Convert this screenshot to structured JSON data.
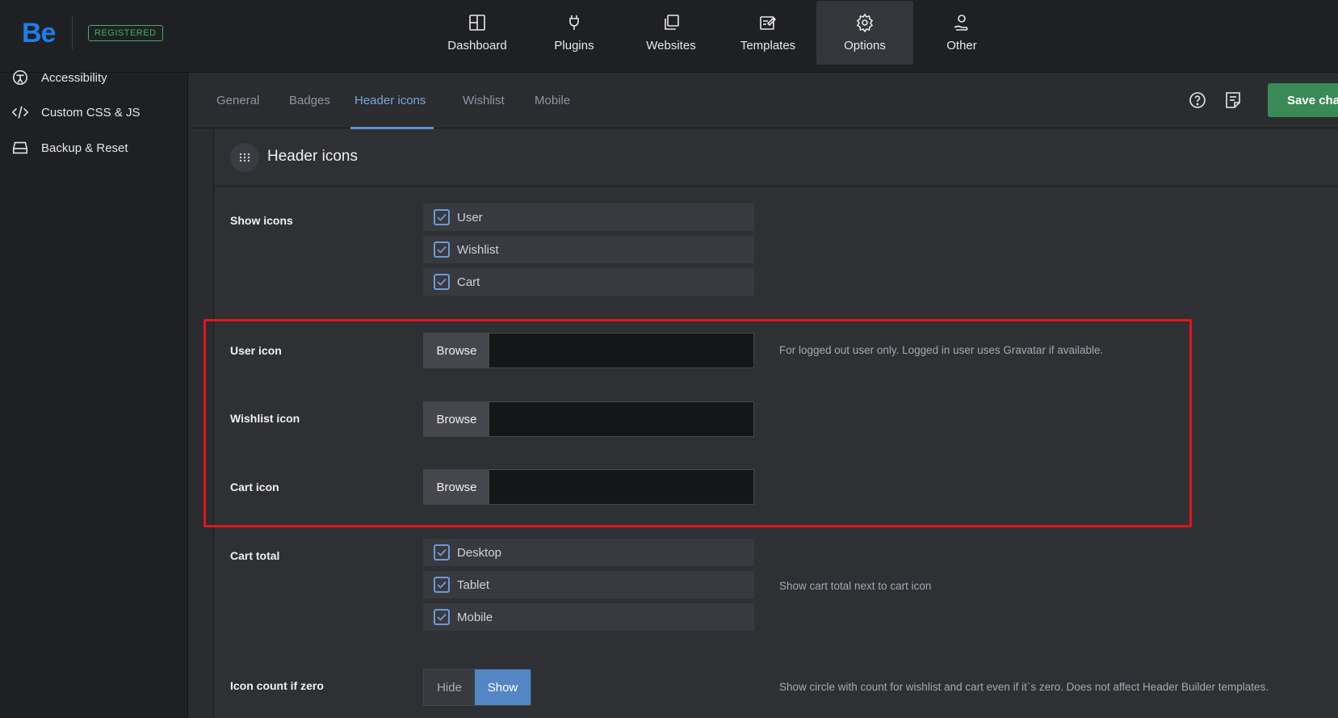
{
  "brand": {
    "logo": "Be",
    "badge": "REGISTERED"
  },
  "nav": {
    "items": [
      {
        "label": "Dashboard",
        "icon": "dashboard-icon"
      },
      {
        "label": "Plugins",
        "icon": "plug-icon"
      },
      {
        "label": "Websites",
        "icon": "websites-icon"
      },
      {
        "label": "Templates",
        "icon": "templates-icon"
      },
      {
        "label": "Options",
        "icon": "gear-icon",
        "active": true
      },
      {
        "label": "Other",
        "icon": "user-hand-icon"
      }
    ]
  },
  "sidebar": {
    "items": [
      {
        "label": "Accessibility",
        "icon": "accessibility-icon"
      },
      {
        "label": "Custom CSS & JS",
        "icon": "code-icon"
      },
      {
        "label": "Backup & Reset",
        "icon": "drive-icon"
      }
    ]
  },
  "subtabs": {
    "items": [
      "General",
      "Badges",
      "Header icons",
      "Wishlist",
      "Mobile"
    ],
    "active": "Header icons"
  },
  "toolbar": {
    "save_label": "Save changes"
  },
  "panel": {
    "title": "Header icons",
    "show_icons": {
      "label": "Show icons",
      "options": [
        {
          "label": "User",
          "checked": true
        },
        {
          "label": "Wishlist",
          "checked": true
        },
        {
          "label": "Cart",
          "checked": true
        }
      ]
    },
    "user_icon": {
      "label": "User icon",
      "button": "Browse",
      "value": "",
      "hint": "For logged out user only. Logged in user uses Gravatar if available."
    },
    "wishlist_icon": {
      "label": "Wishlist icon",
      "button": "Browse",
      "value": ""
    },
    "cart_icon": {
      "label": "Cart icon",
      "button": "Browse",
      "value": ""
    },
    "cart_total": {
      "label": "Cart total",
      "options": [
        {
          "label": "Desktop",
          "checked": true
        },
        {
          "label": "Tablet",
          "checked": true
        },
        {
          "label": "Mobile",
          "checked": true
        }
      ],
      "hint": "Show cart total next to cart icon"
    },
    "icon_count": {
      "label": "Icon count if zero",
      "options": [
        "Hide",
        "Show"
      ],
      "selected": "Show",
      "hint": "Show circle with count for wishlist and cart even if it`s zero. Does not affect Header Builder templates."
    }
  },
  "colors": {
    "accent": "#5d8fd0",
    "save": "#3a8a57",
    "highlight": "#e0161d",
    "brand": "#1e7ee8"
  }
}
